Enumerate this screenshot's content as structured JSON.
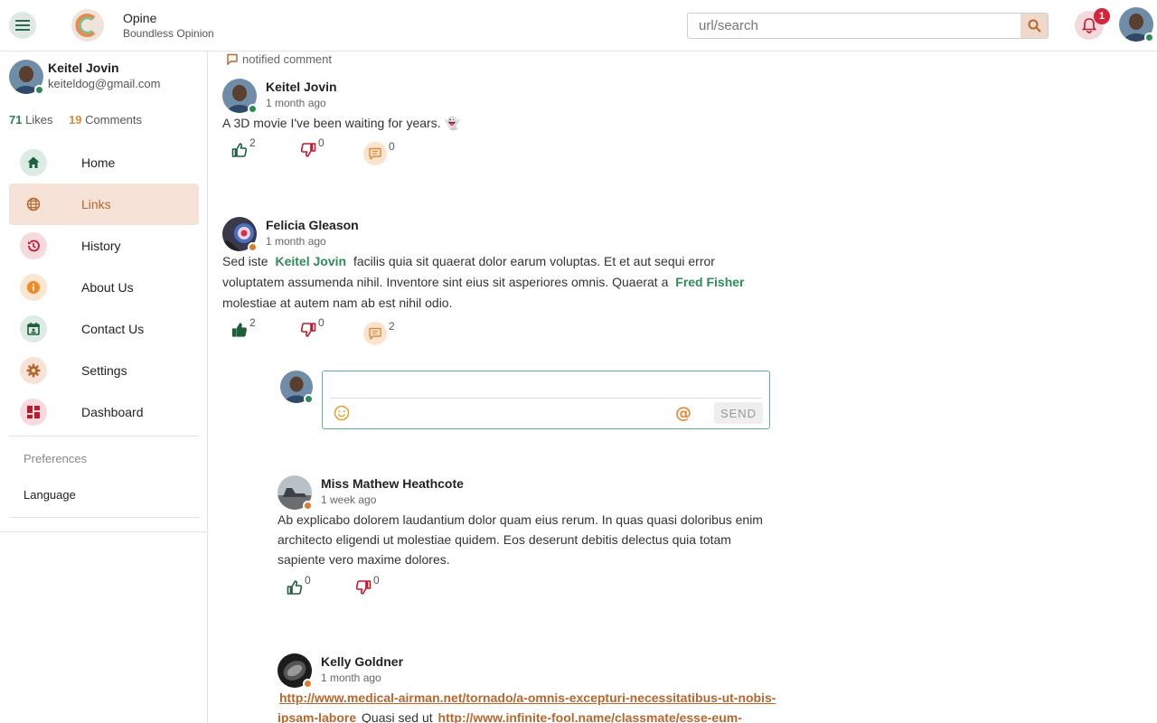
{
  "app": {
    "name": "Opine",
    "tagline": "Boundless Opinion"
  },
  "search": {
    "placeholder": "url/search"
  },
  "notifications": {
    "count": "1"
  },
  "user": {
    "name": "Keitel Jovin",
    "email": "keiteldog@gmail.com",
    "likes": "71",
    "likes_label": "Likes",
    "comments": "19",
    "comments_label": "Comments"
  },
  "nav": [
    {
      "label": "Home",
      "icon": "home-icon"
    },
    {
      "label": "Links",
      "icon": "globe-icon",
      "active": true
    },
    {
      "label": "History",
      "icon": "history-icon"
    },
    {
      "label": "About Us",
      "icon": "info-icon"
    },
    {
      "label": "Contact Us",
      "icon": "calendar-icon"
    },
    {
      "label": "Settings",
      "icon": "gear-icon"
    },
    {
      "label": "Dashboard",
      "icon": "dashboard-icon"
    }
  ],
  "preferences": {
    "heading": "Preferences",
    "language": "Language"
  },
  "feed": {
    "notice": "notified comment",
    "posts": [
      {
        "author": "Keitel Jovin",
        "time": "1 month ago",
        "body": "A 3D movie I've been waiting for years. 👻",
        "likes": "2",
        "dislikes": "0",
        "comments": "0"
      },
      {
        "author": "Felicia Gleason",
        "time": "1 month ago",
        "body_parts": [
          "Sed iste",
          "Keitel Jovin",
          "facilis quia sit quaerat dolor earum voluptas. Et et aut sequi error voluptatem assumenda nihil. Inventore sint eius sit asperiores omnis. Quaerat a",
          "Fred Fisher",
          "molestiae at autem nam ab est nihil odio."
        ],
        "likes": "2",
        "dislikes": "0",
        "comments": "2"
      },
      {
        "author": "Miss Mathew Heathcote",
        "time": "1 week ago",
        "body": "Ab explicabo dolorem laudantium dolor quam eius rerum. In quas quasi doloribus enim architecto eligendi ut molestiae quidem. Eos deserunt debitis delectus quia totam sapiente vero maxime dolores.",
        "likes": "0",
        "dislikes": "0"
      },
      {
        "author": "Kelly Goldner",
        "time": "1 month ago",
        "body_parts": [
          "http://www.medical-airman.net/tornado/a-omnis-excepturi-necessitatibus-ut-nobis-ipsam-labore",
          "Quasi sed ut",
          "http://www.infinite-fool.name/classmate/esse-eum-maiores-"
        ]
      }
    ]
  },
  "reply": {
    "send_label": "SEND"
  },
  "colors": {
    "accent_green": "#2e8b57",
    "accent_orange": "#b5672e",
    "like": "#1f5e3a",
    "dislike": "#c0182c"
  }
}
